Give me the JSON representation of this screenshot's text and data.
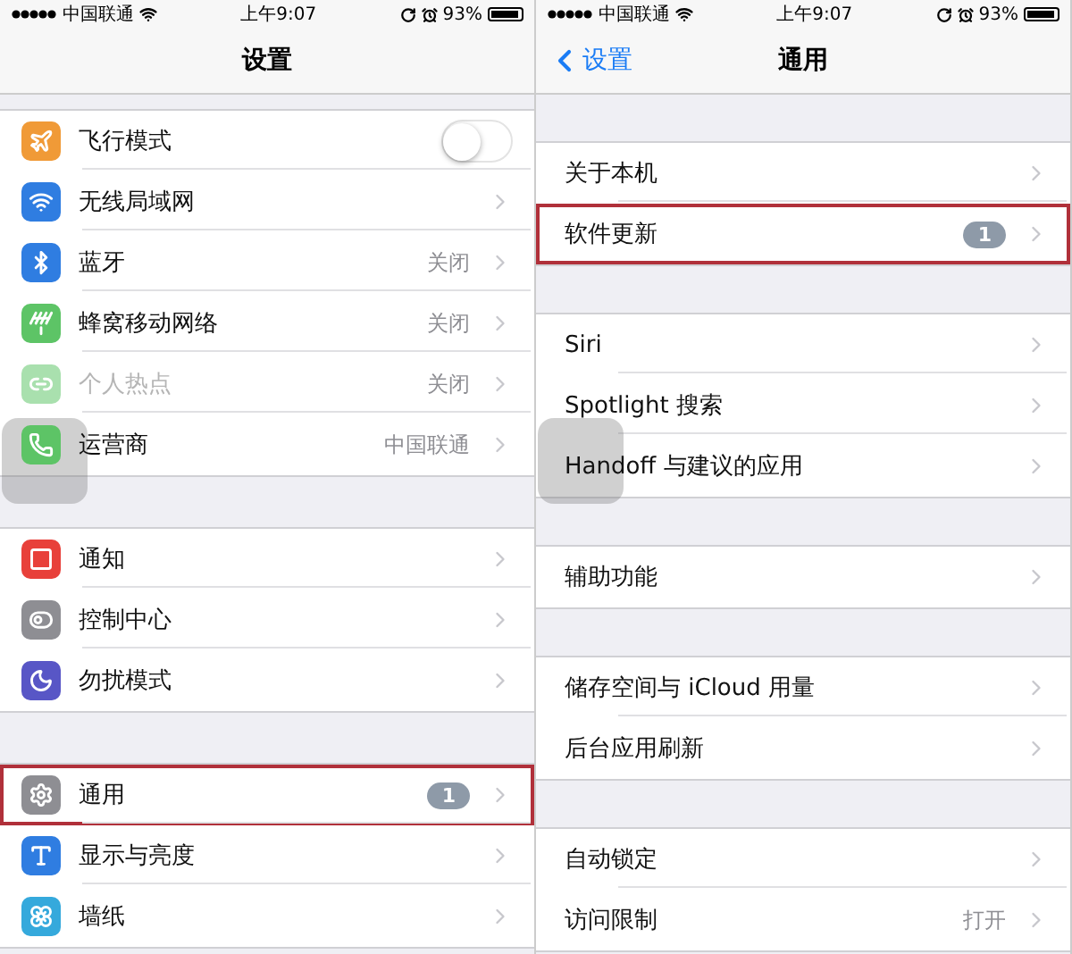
{
  "panels": [
    {
      "status_bar": {
        "carrier": "中国联通",
        "time": "上午9:07",
        "battery": "93%"
      },
      "nav": {
        "title": "设置"
      },
      "groups": [
        {
          "rows": [
            {
              "kind": "toggle",
              "label": "飞行模式",
              "on": false,
              "color": "#f09a37",
              "disabled": false,
              "highlighted": false
            },
            {
              "kind": "link",
              "label": "无线局域网",
              "color": "#2f7de1",
              "disabled": false,
              "highlighted": false
            },
            {
              "kind": "link",
              "label": "蓝牙",
              "value": "关闭",
              "color": "#2f7de1",
              "disabled": false,
              "highlighted": false
            },
            {
              "kind": "link",
              "label": "蜂窝移动网络",
              "value": "关闭",
              "color": "#5dc466",
              "disabled": false,
              "highlighted": false
            },
            {
              "kind": "link",
              "label": "个人热点",
              "value": "关闭",
              "color": "#a9e0ae",
              "disabled": true,
              "highlighted": false
            },
            {
              "kind": "link",
              "label": "运营商",
              "value": "中国联通",
              "color": "#5dc466",
              "disabled": false,
              "highlighted": false
            }
          ]
        },
        {
          "rows": [
            {
              "kind": "link",
              "label": "通知",
              "color": "#e8403a",
              "disabled": false,
              "highlighted": false
            },
            {
              "kind": "link",
              "label": "控制中心",
              "color": "#8e8e93",
              "disabled": false,
              "highlighted": false
            },
            {
              "kind": "link",
              "label": "勿扰模式",
              "color": "#5856c6",
              "disabled": false,
              "highlighted": false
            }
          ]
        },
        {
          "rows": [
            {
              "kind": "link",
              "label": "通用",
              "badge": "1",
              "color": "#8e8e93",
              "disabled": false,
              "highlighted": true
            },
            {
              "kind": "link",
              "label": "显示与亮度",
              "color": "#2f7de1",
              "disabled": false,
              "highlighted": false
            },
            {
              "kind": "link",
              "label": "墙纸",
              "color": "#35a9dc",
              "disabled": false,
              "highlighted": false
            }
          ]
        }
      ]
    },
    {
      "status_bar": {
        "carrier": "中国联通",
        "time": "上午9:07",
        "battery": "93%"
      },
      "nav": {
        "title": "通用",
        "back": "设置"
      },
      "groups": [
        {
          "rows": [
            {
              "kind": "link",
              "label": "关于本机",
              "highlighted": false
            },
            {
              "kind": "link",
              "label": "软件更新",
              "badge": "1",
              "highlighted": true
            }
          ]
        },
        {
          "rows": [
            {
              "kind": "link",
              "label": "Siri",
              "highlighted": false
            },
            {
              "kind": "link",
              "label": "Spotlight 搜索",
              "highlighted": false
            },
            {
              "kind": "link",
              "label": "Handoff 与建议的应用",
              "highlighted": false
            }
          ]
        },
        {
          "rows": [
            {
              "kind": "link",
              "label": "辅助功能",
              "highlighted": false
            }
          ]
        },
        {
          "rows": [
            {
              "kind": "link",
              "label": "储存空间与 iCloud 用量",
              "highlighted": false
            },
            {
              "kind": "link",
              "label": "后台应用刷新",
              "highlighted": false
            }
          ]
        },
        {
          "rows": [
            {
              "kind": "link",
              "label": "自动锁定",
              "highlighted": false
            },
            {
              "kind": "link",
              "label": "访问限制",
              "value": "打开",
              "highlighted": false
            }
          ]
        }
      ]
    }
  ]
}
